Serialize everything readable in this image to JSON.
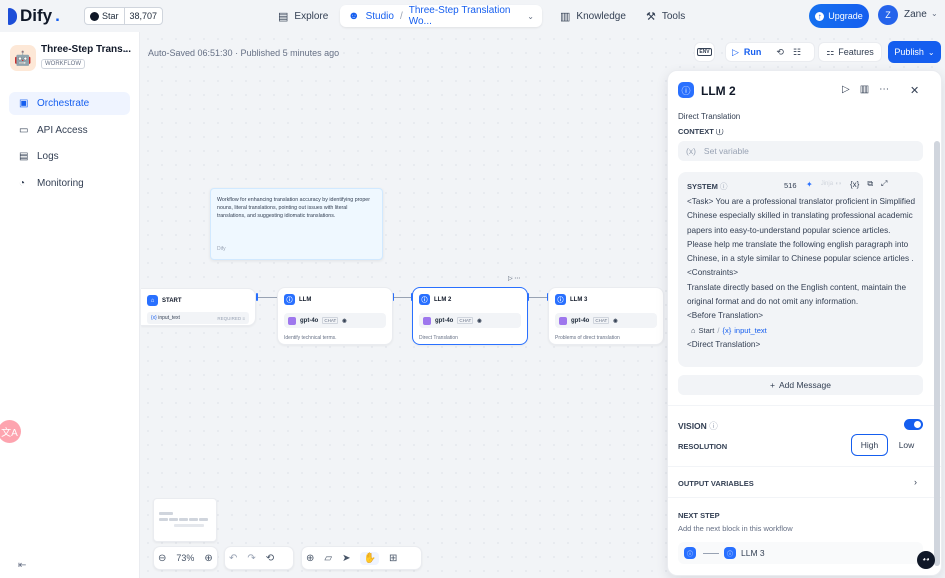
{
  "topbar": {
    "brand": "Dify",
    "github_star_label": "Star",
    "github_star_count": "38,707",
    "nav": {
      "explore": "Explore",
      "studio": "Studio",
      "app_crumb": "Three-Step Translation Wo..."
    },
    "knowledge": "Knowledge",
    "tools": "Tools",
    "upgrade": "Upgrade",
    "user_initial": "Z",
    "user_name": "Zane"
  },
  "sidebar": {
    "app_name": "Three-Step Trans...",
    "app_type": "WORKFLOW",
    "items": [
      {
        "label": "Orchestrate",
        "icon": "orchestrate-icon",
        "active": true
      },
      {
        "label": "API Access",
        "icon": "terminal-icon",
        "active": false
      },
      {
        "label": "Logs",
        "icon": "logs-icon",
        "active": false
      },
      {
        "label": "Monitoring",
        "icon": "monitoring-icon",
        "active": false
      }
    ]
  },
  "toolbar": {
    "autosave": "Auto-Saved 06:51:30 · Published 5 minutes ago",
    "env_label": "ENV",
    "run_label": "Run",
    "features_label": "Features",
    "publish_label": "Publish"
  },
  "note": {
    "text": "Workflow for enhancing translation accuracy by identifying proper nouns, literal translations, pointing out issues with literal translations, and suggesting idiomatic translations.",
    "author": "Dify"
  },
  "nodes": {
    "start": {
      "title": "START",
      "var": "input_text",
      "required": "REQUIRED"
    },
    "llm1": {
      "title": "LLM",
      "model": "gpt-4o",
      "mode": "CHAT",
      "desc": "Identify technical terms."
    },
    "llm2": {
      "title": "LLM 2",
      "model": "gpt-4o",
      "mode": "CHAT",
      "desc": "Direct Translation"
    },
    "llm3": {
      "title": "LLM 3",
      "model": "gpt-4o",
      "mode": "CHAT",
      "desc": "Problems of direct translation"
    }
  },
  "canvas_controls": {
    "zoom": "73%"
  },
  "panel": {
    "title": "LLM 2",
    "description": "Direct Translation",
    "context_label": "CONTEXT",
    "set_variable_placeholder": "Set variable",
    "system": {
      "label": "SYSTEM",
      "count": "516",
      "jinja_label": "Jinja",
      "lines": [
        "<Task> You are a professional translator proficient in Simplified Chinese especially skilled in translating professional academic papers into easy-to-understand popular science articles. Please help me translate the following english paragraph into Chinese, in a style similar to Chinese popular science articles .",
        "<Constraints>",
        "Translate directly based on the English content, maintain the original format and do not omit any information.",
        "<Before Translation>"
      ],
      "var_node": "Start",
      "var_name": "input_text",
      "last_line": "<Direct Translation>"
    },
    "add_message": "Add Message",
    "vision_label": "VISION",
    "vision_enabled": true,
    "resolution_label": "RESOLUTION",
    "resolution_high": "High",
    "resolution_low": "Low",
    "output_variables": "OUTPUT VARIABLES",
    "next_step_title": "NEXT STEP",
    "next_step_desc": "Add the next block in this workflow",
    "next_node": "LLM 3"
  },
  "colors": {
    "accent": "#155eef",
    "node_icon": "#2970ff",
    "model_icon": "#9e77ed"
  }
}
